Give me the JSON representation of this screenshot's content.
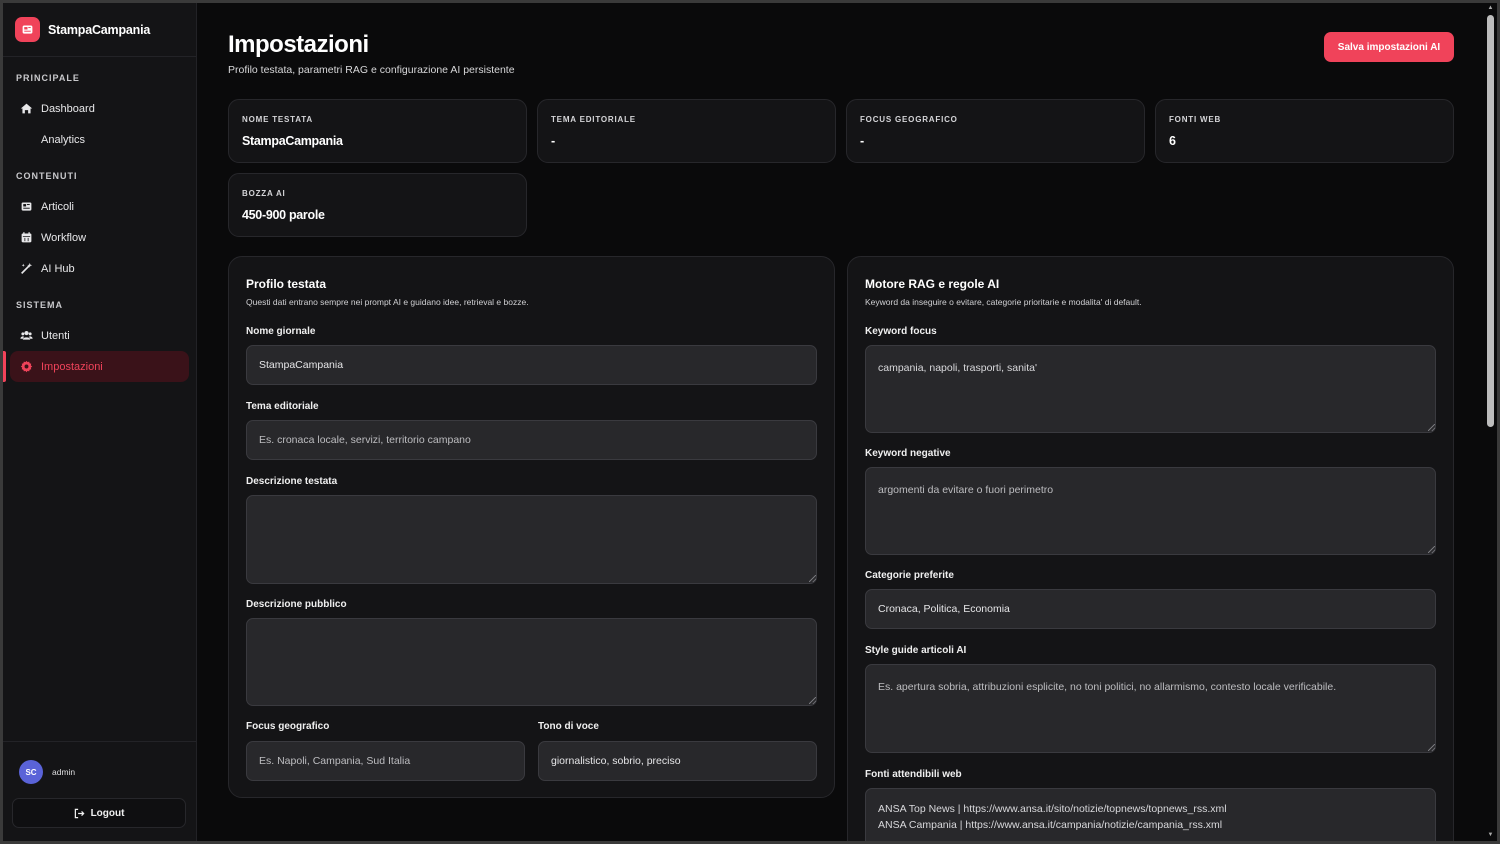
{
  "brand": {
    "name": "StampaCampania"
  },
  "sidebar": {
    "sections": [
      {
        "label": "PRINCIPALE"
      },
      {
        "label": "CONTENUTI"
      },
      {
        "label": "SISTEMA"
      }
    ],
    "items": [
      {
        "label": "Dashboard",
        "icon": "home-icon"
      },
      {
        "label": "Analytics",
        "icon": ""
      },
      {
        "label": "Articoli",
        "icon": "newspaper-icon"
      },
      {
        "label": "Workflow",
        "icon": "calendar-icon"
      },
      {
        "label": "AI Hub",
        "icon": "magic-wand-icon"
      },
      {
        "label": "Utenti",
        "icon": "users-icon"
      },
      {
        "label": "Impostazioni",
        "icon": "gear-icon"
      }
    ],
    "user": {
      "initials": "SC",
      "name": "admin"
    },
    "logout_label": "Logout"
  },
  "header": {
    "title": "Impostazioni",
    "subtitle": "Profilo testata, parametri RAG e configurazione AI persistente",
    "save_label": "Salva impostazioni AI"
  },
  "stats": [
    {
      "label": "NOME TESTATA",
      "value": "StampaCampania"
    },
    {
      "label": "TEMA EDITORIALE",
      "value": "-"
    },
    {
      "label": "FOCUS GEOGRAFICO",
      "value": "-"
    },
    {
      "label": "FONTI WEB",
      "value": "6"
    },
    {
      "label": "BOZZA AI",
      "value": "450-900 parole"
    }
  ],
  "profile_panel": {
    "title": "Profilo testata",
    "subtitle": "Questi dati entrano sempre nei prompt AI e guidano idee, retrieval e bozze.",
    "nome_label": "Nome giornale",
    "nome_value": "StampaCampania",
    "tema_label": "Tema editoriale",
    "tema_placeholder": "Es. cronaca locale, servizi, territorio campano",
    "descrizione_label": "Descrizione testata",
    "descrizione_value": "",
    "pubblico_label": "Descrizione pubblico",
    "pubblico_value": "",
    "focus_label": "Focus geografico",
    "focus_placeholder": "Es. Napoli, Campania, Sud Italia",
    "tono_label": "Tono di voce",
    "tono_value": "giornalistico, sobrio, preciso"
  },
  "rag_panel": {
    "title": "Motore RAG e regole AI",
    "subtitle": "Keyword da inseguire o evitare, categorie prioritarie e modalita' di default.",
    "keyword_focus_label": "Keyword focus",
    "keyword_focus_value": "campania, napoli, trasporti, sanita'",
    "keyword_negative_label": "Keyword negative",
    "keyword_negative_placeholder": "argomenti da evitare o fuori perimetro",
    "categorie_label": "Categorie preferite",
    "categorie_value": "Cronaca, Politica, Economia",
    "style_label": "Style guide articoli AI",
    "style_placeholder": "Es. apertura sobria, attribuzioni esplicite, no toni politici, no allarmismo, contesto locale verificabile.",
    "fonti_label": "Fonti attendibili web",
    "fonti_lines": [
      "ANSA Top News | https://www.ansa.it/sito/notizie/topnews/topnews_rss.xml",
      "ANSA Campania | https://www.ansa.it/campania/notizie/campania_rss.xml"
    ]
  },
  "colors": {
    "accent": "#f0435a",
    "background": "#0a0a0b",
    "panel": "#141416",
    "avatar": "#5a63d8"
  }
}
